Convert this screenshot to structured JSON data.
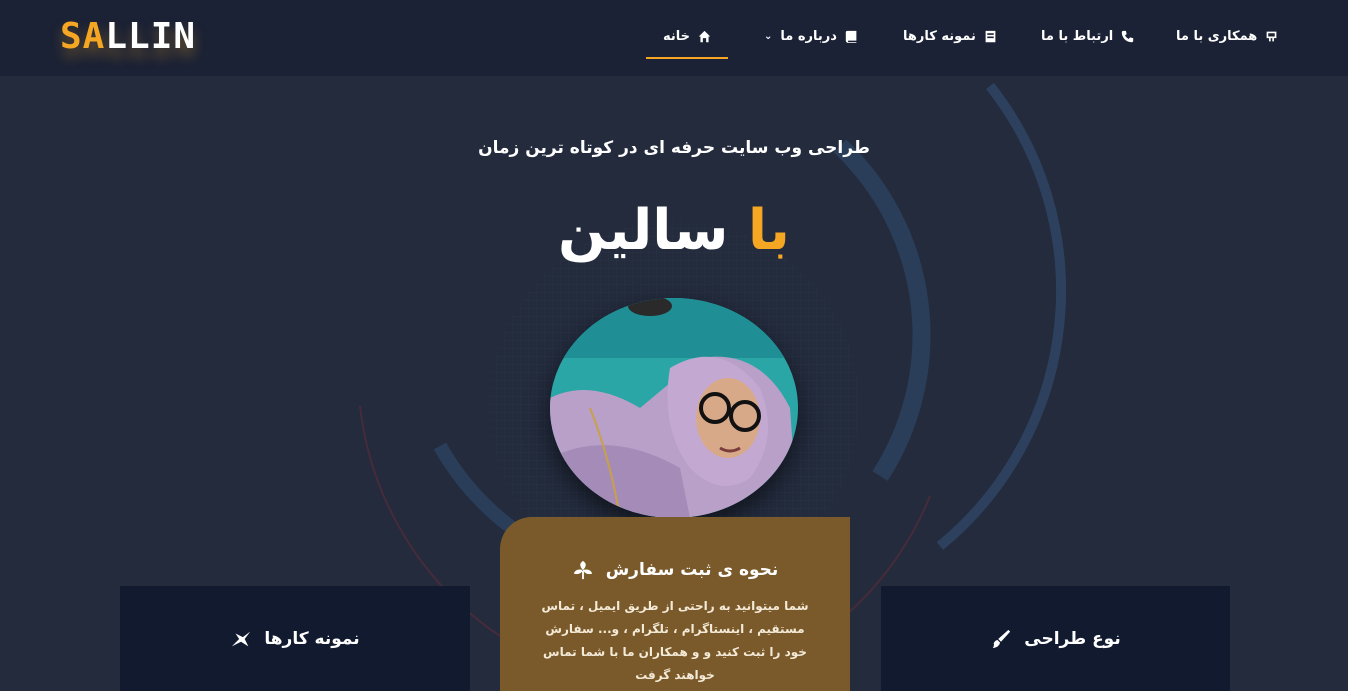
{
  "brand": {
    "logo_part1": "SA",
    "logo_part2": "LLIN"
  },
  "nav": {
    "cooperate": "همکاری با ما",
    "contact": "ارتباط با ما",
    "portfolio": "نمونه کارها",
    "about": "درباره ما",
    "home": "خانه"
  },
  "hero": {
    "tagline": "طراحی وب سایت حرفه ای در کوتاه ترین زمان",
    "title_accent": "با",
    "title_main": "سالین"
  },
  "cards": {
    "left_title": "نمونه کارها",
    "middle_title": "نحوه ی ثبت سفارش",
    "middle_text": "شما میتوانید به راحتی از طریق ایمیل ، تماس مستقیم ، اینستاگرام ، تلگرام ، و... سفارش خود را ثبت کنید و و همکاران ما با شما تماس خواهند گرفت",
    "right_title": "نوع طراحی"
  },
  "icons": {
    "cooperate": "handshake-icon",
    "contact": "phone-icon",
    "portfolio": "document-icon",
    "about": "book-icon",
    "home": "home-icon",
    "left_card": "acrobat-icon",
    "middle_card": "leaf-icon",
    "right_card": "brush-icon"
  },
  "colors": {
    "accent": "#f5a623",
    "background": "#232b3d",
    "topbar": "#1b2235",
    "card": "#121a30",
    "card_highlight": "#7a5a2a"
  }
}
